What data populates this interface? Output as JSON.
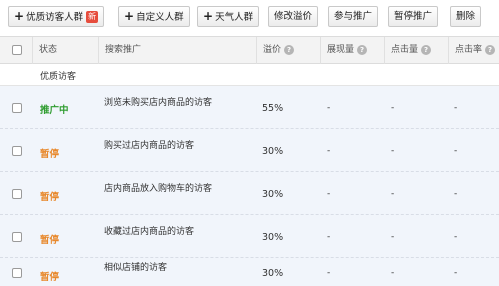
{
  "toolbar": {
    "add_quality_label": "优质访客人群",
    "new_badge": "新",
    "add_custom_label": "自定义人群",
    "add_weather_label": "天气人群",
    "edit_price_label": "修改溢价",
    "join_promo_label": "参与推广",
    "pause_promo_label": "暂停推广",
    "delete_label": "删除",
    "plus": "+"
  },
  "table": {
    "headers": {
      "status": "状态",
      "search_promo": "搜索推广",
      "premium": "溢价",
      "impressions": "展现量",
      "clicks": "点击量",
      "ctr": "点击率"
    },
    "help_icon": "?",
    "group_label": "优质访客",
    "rows": [
      {
        "status": "推广中",
        "status_color": "#2e9c2e",
        "name": "浏览未购买店内商品的访客",
        "premium": "55%",
        "impressions": "-",
        "clicks": "-",
        "ctr": "-"
      },
      {
        "status": "暂停",
        "status_color": "#e8892d",
        "name": "购买过店内商品的访客",
        "premium": "30%",
        "impressions": "-",
        "clicks": "-",
        "ctr": "-"
      },
      {
        "status": "暂停",
        "status_color": "#e8892d",
        "name": "店内商品放入购物车的访客",
        "premium": "30%",
        "impressions": "-",
        "clicks": "-",
        "ctr": "-"
      },
      {
        "status": "暂停",
        "status_color": "#e8892d",
        "name": "收藏过店内商品的访客",
        "premium": "30%",
        "impressions": "-",
        "clicks": "-",
        "ctr": "-"
      },
      {
        "status": "暂停",
        "status_color": "#e8892d",
        "name": "相似店铺的访客",
        "premium": "30%",
        "impressions": "-",
        "clicks": "-",
        "ctr": "-"
      }
    ]
  }
}
